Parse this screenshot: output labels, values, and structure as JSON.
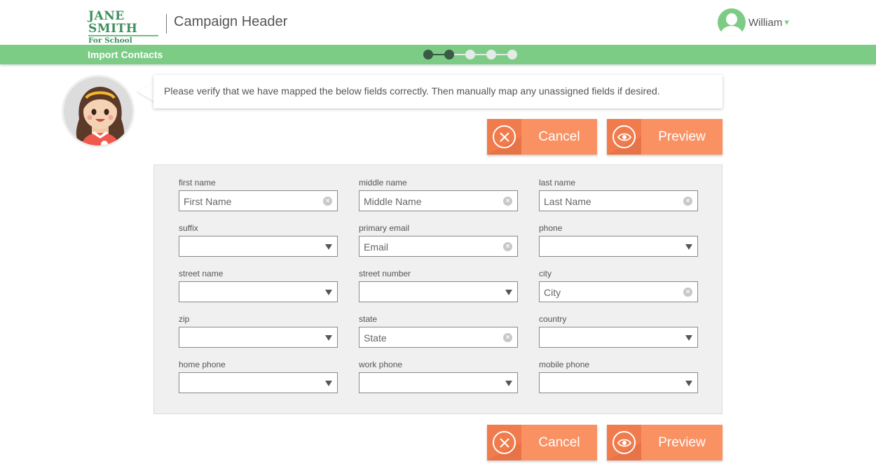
{
  "header": {
    "logo_name": "JANE SMITH",
    "logo_sub": "For School Board",
    "campaign_title": "Campaign Header",
    "user_name": "William",
    "user_caret": "▾"
  },
  "greenbar": {
    "section_title": "Import Contacts",
    "steps_total": 5,
    "steps_completed": 2
  },
  "message": "Please verify that we have mapped the below fields correctly. Then manually map any unassigned fields if desired.",
  "buttons": {
    "cancel": "Cancel",
    "preview": "Preview"
  },
  "fields": [
    {
      "label": "first name",
      "type": "text",
      "value": "First Name"
    },
    {
      "label": "middle name",
      "type": "text",
      "value": "Middle Name"
    },
    {
      "label": "last name",
      "type": "text",
      "value": "Last Name"
    },
    {
      "label": "suffix",
      "type": "select",
      "value": ""
    },
    {
      "label": "primary email",
      "type": "text",
      "value": "Email"
    },
    {
      "label": "phone",
      "type": "select",
      "value": ""
    },
    {
      "label": "street name",
      "type": "select",
      "value": ""
    },
    {
      "label": "street number",
      "type": "select",
      "value": ""
    },
    {
      "label": "city",
      "type": "text",
      "value": "City"
    },
    {
      "label": "zip",
      "type": "select",
      "value": ""
    },
    {
      "label": "state",
      "type": "text",
      "value": "State"
    },
    {
      "label": "country",
      "type": "select",
      "value": ""
    },
    {
      "label": "home phone",
      "type": "select",
      "value": ""
    },
    {
      "label": "work phone",
      "type": "select",
      "value": ""
    },
    {
      "label": "mobile phone",
      "type": "select",
      "value": ""
    }
  ],
  "colors": {
    "brand_green": "#7ccc86",
    "logo_green": "#3e8f5c",
    "button_orange": "#f99163",
    "step_done": "#3a5a45",
    "step_todo": "#e3ebe5"
  },
  "icons": {
    "cancel": "x-circle-icon",
    "preview": "eye-icon",
    "clear": "clear-x-icon",
    "dropdown": "triangle-down-icon",
    "avatar": "user-avatar-icon"
  }
}
